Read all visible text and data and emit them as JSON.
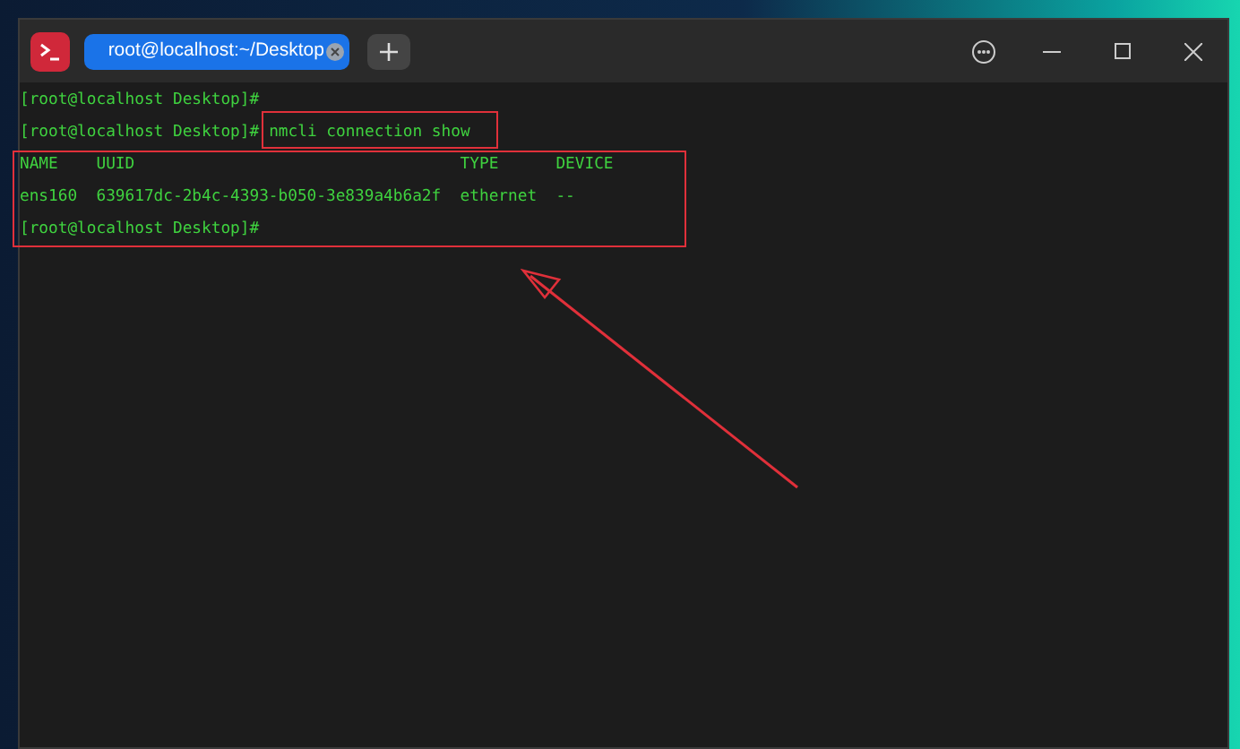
{
  "window": {
    "tab": {
      "title": "root@localhost:~/Desktop",
      "selected": true
    }
  },
  "terminal": {
    "lines": [
      {
        "kind": "prompt",
        "prompt": "[root@localhost Desktop]#"
      },
      {
        "kind": "prompt",
        "prompt": "[root@localhost Desktop]#",
        "command": "nmcli connection show"
      },
      {
        "kind": "output",
        "text": "NAME    UUID                                  TYPE      DEVICE"
      },
      {
        "kind": "output",
        "text": "ens160  639617dc-2b4c-4393-b050-3e839a4b6a2f  ethernet  --"
      },
      {
        "kind": "prompt",
        "prompt": "[root@localhost Desktop]#"
      }
    ]
  }
}
